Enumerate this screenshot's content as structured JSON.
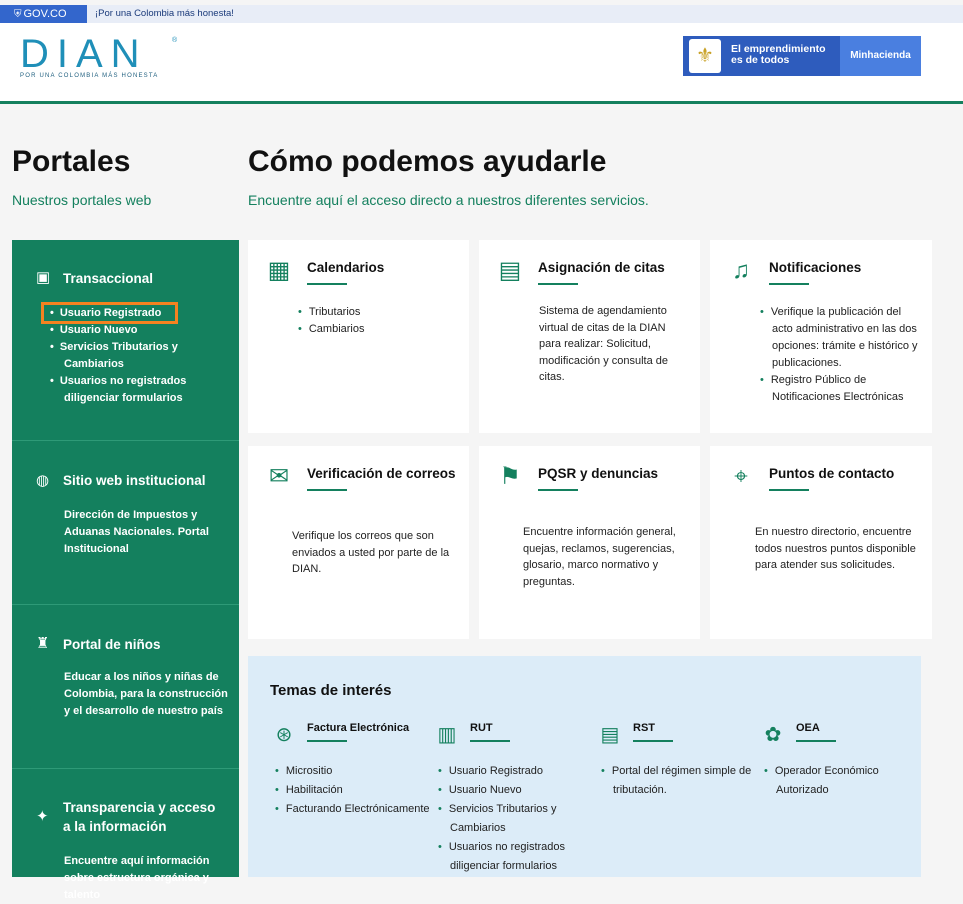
{
  "govbar": {
    "brand": "GOV.CO",
    "tagline": "¡Por una Colombia más honesta!"
  },
  "header": {
    "logo_word": "DIAN",
    "logo_tagline": "POR UNA COLOMBIA MÁS HONESTA",
    "logo_reg": "®",
    "badge_line1": "El emprendimiento",
    "badge_line2": "es de todos",
    "badge_right": "Minhacienda"
  },
  "headings": {
    "portales_title": "Portales",
    "portales_sub": "Nuestros portales web",
    "ayudar_title": "Cómo podemos ayudarle",
    "ayudar_sub": "Encuentre aquí el acceso directo a nuestros diferentes servicios."
  },
  "sidebar": {
    "sections": [
      {
        "title": "Transaccional",
        "icon": "transaction-icon",
        "items": [
          "Usuario Registrado",
          "Usuario Nuevo",
          "Servicios Tributarios y Cambiarios",
          "Usuarios no registrados diligenciar formularios"
        ]
      },
      {
        "title": "Sitio web institucional",
        "icon": "globe-icon",
        "desc": "Dirección de Impuestos y Aduanas Nacionales. Portal Institucional"
      },
      {
        "title": "Portal de niños",
        "icon": "children-icon",
        "desc": "Educar a los niños y niñas de Colombia, para la construcción y el desarrollo de nuestro país"
      },
      {
        "title_line1": "Transparencia y acceso",
        "title_line2": "a la información",
        "icon": "transparency-icon",
        "desc": "Encuentre aquí información sobre estructura orgánica y talento"
      }
    ]
  },
  "cards": [
    {
      "title": "Calendarios",
      "icon": "calendar-icon",
      "items": [
        "Tributarios",
        "Cambiarios"
      ]
    },
    {
      "title": "Asignación de citas",
      "icon": "appointment-icon",
      "text": "Sistema de agendamiento virtual de citas de la DIAN para realizar: Solicitud, modificación y consulta de citas."
    },
    {
      "title": "Notificaciones",
      "icon": "notification-icon",
      "items": [
        "Verifique la publicación del acto administrativo en las dos opciones: trámite e histórico y publicaciones.",
        "Registro Público de Notificaciones Electrónicas"
      ]
    },
    {
      "title": "Verificación de correos",
      "icon": "mail-check-icon",
      "text": "Verifique los correos que son enviados a usted por parte de la DIAN."
    },
    {
      "title": "PQSR y denuncias",
      "icon": "complaint-icon",
      "text": "Encuentre información general, quejas, reclamos, sugerencias, glosario, marco normativo y preguntas."
    },
    {
      "title": "Puntos de contacto",
      "icon": "location-pin-icon",
      "text": "En nuestro directorio, encuentre todos nuestros puntos disponible para atender sus solicitudes."
    }
  ],
  "temas": {
    "title": "Temas de interés",
    "items": [
      {
        "title": "Factura Electrónica",
        "icon": "invoice-icon",
        "links": [
          "Micrositio",
          "Habilitación",
          "Facturando Electrónicamente"
        ]
      },
      {
        "title": "RUT",
        "icon": "rut-icon",
        "links": [
          "Usuario Registrado",
          "Usuario Nuevo",
          "Servicios Tributarios y Cambiarios",
          "Usuarios no registrados diligenciar formularios"
        ]
      },
      {
        "title": "RST",
        "icon": "rst-icon",
        "links": [
          "Portal del régimen simple de tributación."
        ]
      },
      {
        "title": "OEA",
        "icon": "oea-icon",
        "links": [
          "Operador Económico Autorizado"
        ]
      }
    ]
  },
  "colors": {
    "primary_green": "#14805e",
    "gov_blue": "#3366cc",
    "highlight_orange": "#f58220",
    "temas_bg": "#dcecf8"
  }
}
